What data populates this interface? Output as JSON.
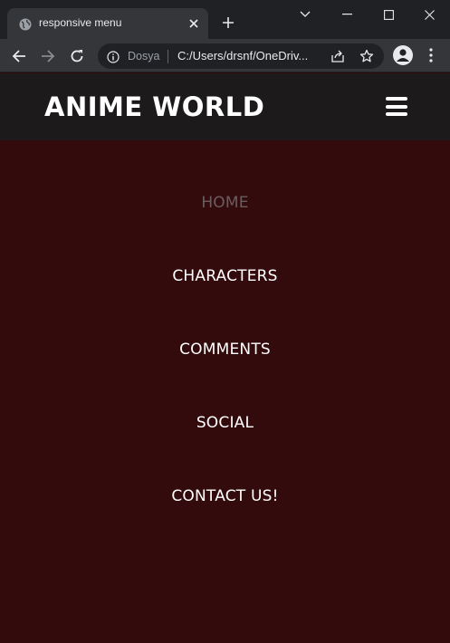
{
  "browser": {
    "tab_title": "responsive menu",
    "new_tab_symbol": "+",
    "site_label": "Dosya",
    "url": "C:/Users/drsnf/OneDriv...",
    "icons": [
      "globe-icon",
      "close-icon",
      "plus-icon",
      "chevron-down-icon",
      "minimize-icon",
      "maximize-icon",
      "close-window-icon",
      "back-arrow-icon",
      "forward-arrow-icon",
      "reload-icon",
      "info-icon",
      "share-icon",
      "star-icon",
      "profile-icon",
      "more-vert-icon"
    ]
  },
  "site": {
    "brand": "ANIME WORLD",
    "menu_icon": "hamburger-icon",
    "nav": [
      {
        "label": "HOME",
        "active": true
      },
      {
        "label": "CHARACTERS",
        "active": false
      },
      {
        "label": "COMMENTS",
        "active": false
      },
      {
        "label": "SOCIAL",
        "active": false
      },
      {
        "label": "CONTACT US!",
        "active": false
      }
    ]
  },
  "colors": {
    "header_bg": "#1c1a1a",
    "menu_bg": "#330b0d",
    "active_link": "#6b5d5e",
    "link": "#ffffff"
  }
}
